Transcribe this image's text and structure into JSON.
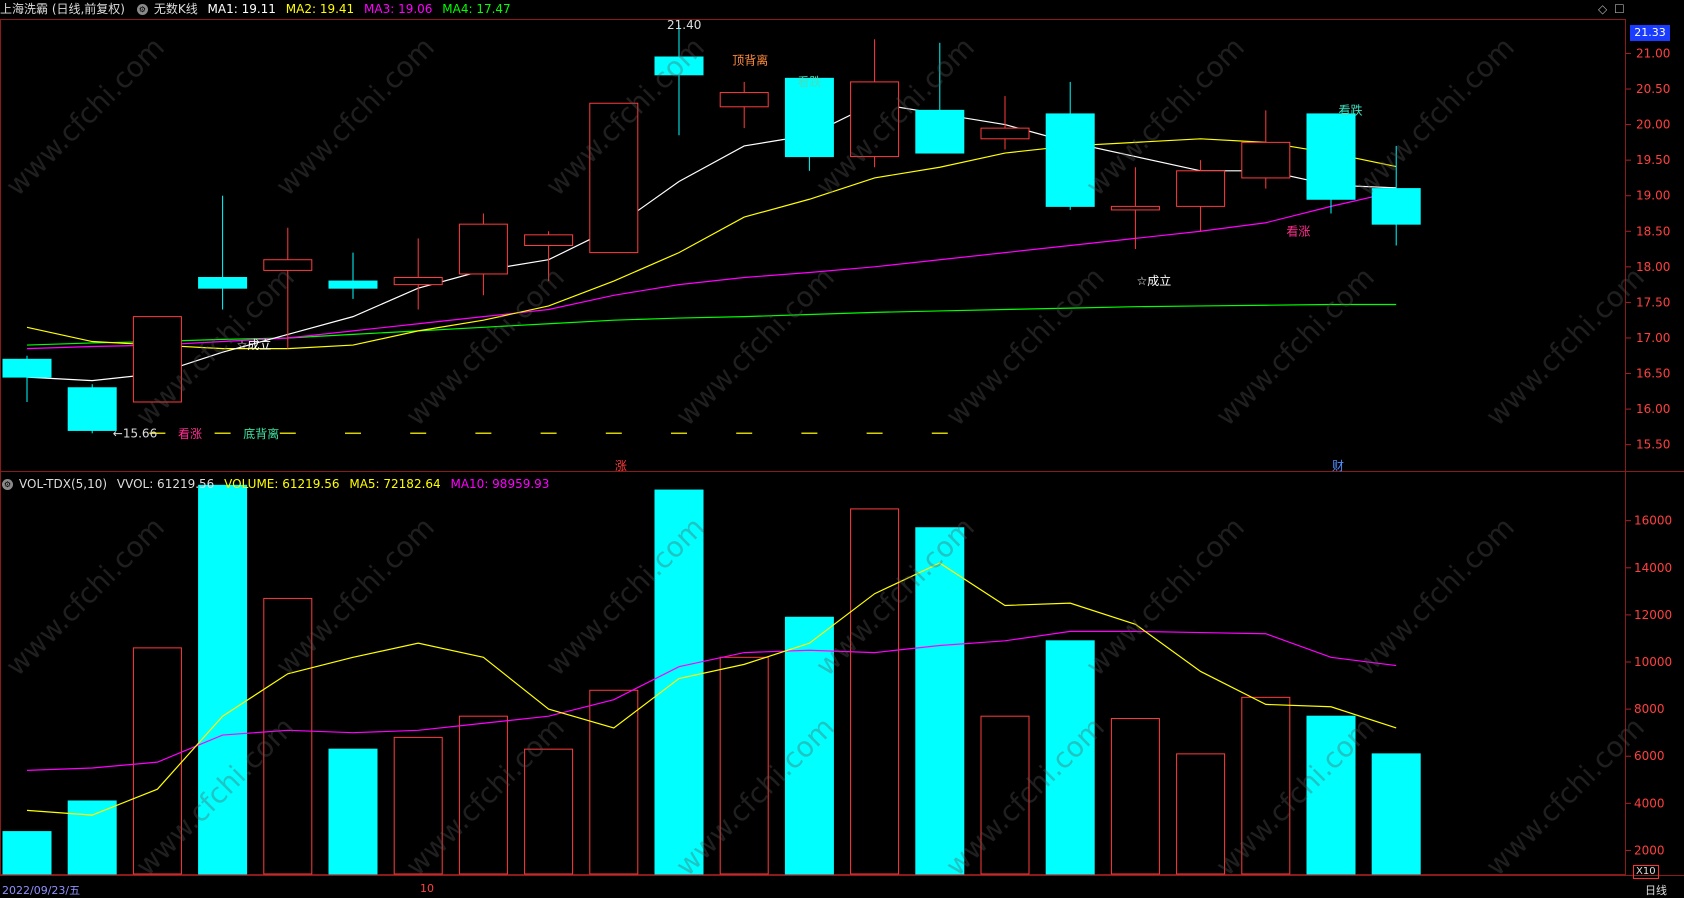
{
  "header": {
    "stock_name": "上海洗霸 (日线,前复权)",
    "kline_label": "无数K线",
    "ma1": "MA1: 19.11",
    "ma2": "MA2: 19.41",
    "ma3": "MA3: 19.06",
    "ma4": "MA4: 17.47"
  },
  "vol_header": {
    "indicator": "VOL-TDX(5,10)",
    "vvol": "VVOL: 61219.56",
    "volume": "VOLUME: 61219.56",
    "ma5": "MA5: 72182.64",
    "ma10": "MA10: 98959.93"
  },
  "footer": {
    "date": "2022/09/23/五",
    "month_mark": "10",
    "period": "日线",
    "scale": "X10"
  },
  "price_tag": "21.33",
  "watermark": "www.cfchi.com",
  "colors": {
    "up": "#ff3c3c",
    "down": "#00ffff",
    "ma1": "#ffffff",
    "ma2": "#ffff00",
    "ma3": "#ff00ff",
    "ma4": "#00ff00"
  },
  "chart_data": [
    {
      "type": "candlestick",
      "ylim": [
        15.2,
        21.4
      ],
      "yticks": [
        "21.00",
        "20.50",
        "20.00",
        "19.50",
        "19.00",
        "18.50",
        "18.00",
        "17.50",
        "17.00",
        "16.50",
        "16.00",
        "15.50"
      ],
      "candles": [
        {
          "o": 16.7,
          "c": 16.45,
          "h": 16.75,
          "l": 16.1
        },
        {
          "o": 16.3,
          "c": 15.7,
          "h": 16.35,
          "l": 15.66
        },
        {
          "o": 16.1,
          "c": 17.3,
          "h": 17.3,
          "l": 16.1
        },
        {
          "o": 17.85,
          "c": 17.7,
          "h": 19.0,
          "l": 17.4
        },
        {
          "o": 17.95,
          "c": 18.1,
          "h": 18.55,
          "l": 16.85
        },
        {
          "o": 17.8,
          "c": 17.7,
          "h": 18.2,
          "l": 17.55
        },
        {
          "o": 17.75,
          "c": 17.85,
          "h": 18.4,
          "l": 17.4
        },
        {
          "o": 17.9,
          "c": 18.6,
          "h": 18.75,
          "l": 17.6
        },
        {
          "o": 18.3,
          "c": 18.45,
          "h": 18.5,
          "l": 17.8
        },
        {
          "o": 18.2,
          "c": 20.3,
          "h": 20.3,
          "l": 18.2
        },
        {
          "o": 20.95,
          "c": 20.7,
          "h": 21.4,
          "l": 19.85
        },
        {
          "o": 20.25,
          "c": 20.45,
          "h": 20.6,
          "l": 19.95
        },
        {
          "o": 20.65,
          "c": 19.55,
          "h": 20.65,
          "l": 19.35
        },
        {
          "o": 19.55,
          "c": 20.6,
          "h": 21.2,
          "l": 19.4
        },
        {
          "o": 20.2,
          "c": 19.6,
          "h": 21.15,
          "l": 19.6
        },
        {
          "o": 19.8,
          "c": 19.95,
          "h": 20.4,
          "l": 19.65
        },
        {
          "o": 20.15,
          "c": 18.85,
          "h": 20.6,
          "l": 18.8
        },
        {
          "o": 18.8,
          "c": 18.85,
          "h": 19.4,
          "l": 18.25
        },
        {
          "o": 18.85,
          "c": 19.35,
          "h": 19.5,
          "l": 18.5
        },
        {
          "o": 19.25,
          "c": 19.75,
          "h": 20.2,
          "l": 19.1
        },
        {
          "o": 20.15,
          "c": 18.95,
          "h": 20.15,
          "l": 18.75
        },
        {
          "o": 19.1,
          "c": 18.6,
          "h": 19.7,
          "l": 18.3
        }
      ],
      "ma1": [
        16.45,
        16.4,
        16.5,
        16.8,
        17.05,
        17.3,
        17.7,
        17.95,
        18.1,
        18.55,
        19.2,
        19.7,
        19.85,
        20.3,
        20.15,
        20.0,
        19.75,
        19.55,
        19.35,
        19.35,
        19.15,
        19.11
      ],
      "ma2": [
        17.15,
        16.95,
        16.9,
        16.85,
        16.85,
        16.9,
        17.1,
        17.25,
        17.45,
        17.8,
        18.2,
        18.7,
        18.95,
        19.25,
        19.4,
        19.6,
        19.7,
        19.75,
        19.8,
        19.75,
        19.6,
        19.41
      ],
      "ma3": [
        16.85,
        16.88,
        16.9,
        16.95,
        17.0,
        17.1,
        17.2,
        17.3,
        17.4,
        17.6,
        17.75,
        17.85,
        17.92,
        18.0,
        18.1,
        18.2,
        18.3,
        18.4,
        18.5,
        18.62,
        18.85,
        19.06
      ],
      "ma4": [
        16.9,
        16.93,
        16.95,
        16.98,
        17.0,
        17.05,
        17.1,
        17.15,
        17.2,
        17.25,
        17.28,
        17.3,
        17.33,
        17.36,
        17.38,
        17.4,
        17.42,
        17.44,
        17.45,
        17.46,
        17.47,
        17.47
      ],
      "annotations": [
        {
          "text": "21.40",
          "i": 10,
          "y": 21.4,
          "color": "#dddddd"
        },
        {
          "text": "←15.66",
          "i": 1.5,
          "y": 15.66,
          "color": "#dddddd"
        },
        {
          "text": "顶背离",
          "i": 11,
          "y": 20.9,
          "color": "#ff8c3c"
        },
        {
          "text": "看跌",
          "i": 12,
          "y": 20.6,
          "color": "#40e0c0"
        },
        {
          "text": "☆成立",
          "i": 3.4,
          "y": 16.9,
          "color": "#ffffff"
        },
        {
          "text": "看涨",
          "i": 2.5,
          "y": 15.65,
          "color": "#ff3090"
        },
        {
          "text": "底背离",
          "i": 3.5,
          "y": 15.65,
          "color": "#40e0a0"
        },
        {
          "text": "☆成立",
          "i": 17.2,
          "y": 17.8,
          "color": "#ffffff"
        },
        {
          "text": "看涨",
          "i": 19.5,
          "y": 18.5,
          "color": "#ff3090"
        },
        {
          "text": "看跌",
          "i": 20.3,
          "y": 20.2,
          "color": "#40e0c0"
        },
        {
          "text": "涨",
          "i": 9.2,
          "y": 15.2,
          "color": "#ff3c3c"
        },
        {
          "text": "财",
          "i": 20.2,
          "y": 15.2,
          "color": "#5090ff"
        }
      ]
    },
    {
      "type": "bar",
      "ylim": [
        1000,
        17600
      ],
      "yticks": [
        "16000",
        "14000",
        "12000",
        "10000",
        "8000",
        "6000",
        "4000",
        "2000"
      ],
      "volume": [
        2800,
        4100,
        10600,
        17500,
        12700,
        6300,
        6800,
        7700,
        6300,
        8800,
        17300,
        10200,
        11900,
        16500,
        15700,
        7700,
        10900,
        7600,
        6100,
        8500,
        7700,
        6100
      ],
      "up": [
        false,
        false,
        true,
        false,
        true,
        false,
        true,
        true,
        true,
        true,
        false,
        true,
        false,
        true,
        false,
        true,
        false,
        true,
        true,
        true,
        false,
        false
      ],
      "ma5": [
        3700,
        3500,
        4600,
        7700,
        9500,
        10200,
        10800,
        10200,
        8000,
        7200,
        9300,
        9900,
        10800,
        12900,
        14200,
        12400,
        12500,
        11600,
        9600,
        8200,
        8100,
        7200
      ],
      "ma10": [
        5400,
        5500,
        5750,
        6900,
        7100,
        7000,
        7100,
        7400,
        7700,
        8400,
        9800,
        10400,
        10500,
        10400,
        10700,
        10900,
        11300,
        11300,
        11250,
        11200,
        10200,
        9850
      ]
    }
  ]
}
